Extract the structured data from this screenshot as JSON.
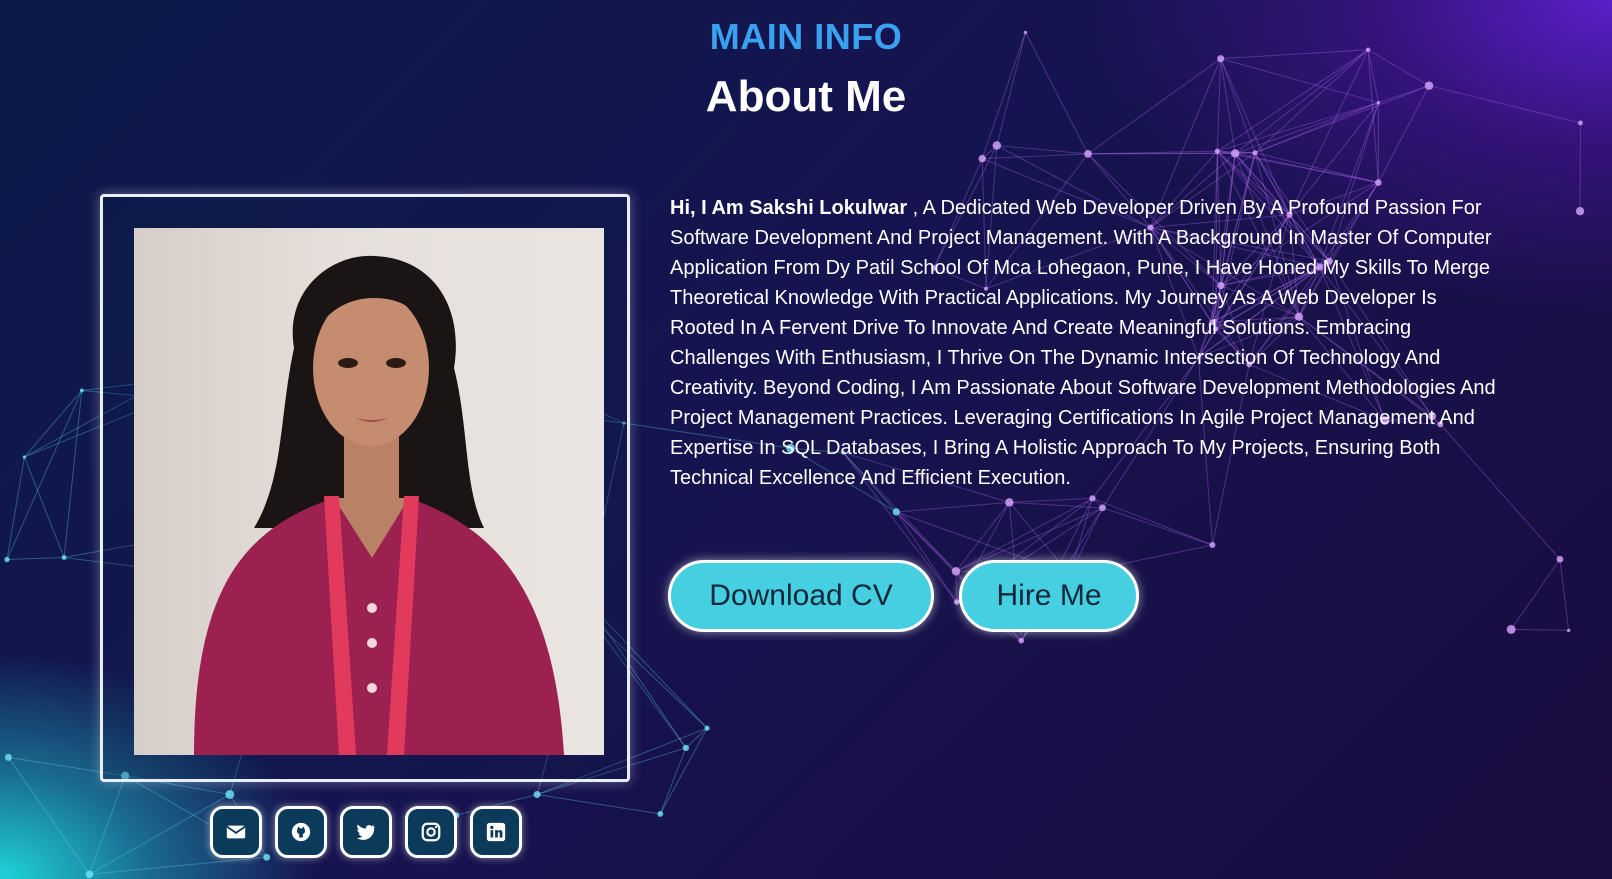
{
  "header": {
    "kicker": "MAIN INFO",
    "title": "About Me"
  },
  "profile": {
    "photo_alt": "portrait-photo"
  },
  "bio": {
    "name_intro": "Hi, I Am Sakshi Lokulwar",
    "text": " , A Dedicated Web Developer Driven By A Profound Passion For Software Development And Project Management. With A Background In Master Of Computer Application From Dy Patil School Of Mca Lohegaon, Pune, I Have Honed My Skills To Merge Theoretical Knowledge With Practical Applications. My Journey As A Web Developer Is Rooted In A Fervent Drive To Innovate And Create Meaningful Solutions. Embracing Challenges With Enthusiasm, I Thrive On The Dynamic Intersection Of Technology And Creativity. Beyond Coding, I Am Passionate About Software Development Methodologies And Project Management Practices. Leveraging Certifications In Agile Project Management And Expertise In SQL Databases, I Bring A Holistic Approach To My Projects, Ensuring Both Technical Excellence And Efficient Execution."
  },
  "buttons": {
    "download_cv": "Download CV",
    "hire_me": "Hire Me"
  },
  "socials": [
    {
      "icon": "envelope-icon"
    },
    {
      "icon": "github-icon"
    },
    {
      "icon": "twitter-icon"
    },
    {
      "icon": "instagram-icon"
    },
    {
      "icon": "linkedin-icon"
    }
  ],
  "colors": {
    "accent": "#46cfe0",
    "kicker": "#3aa0f0",
    "text": "#ffffff"
  }
}
